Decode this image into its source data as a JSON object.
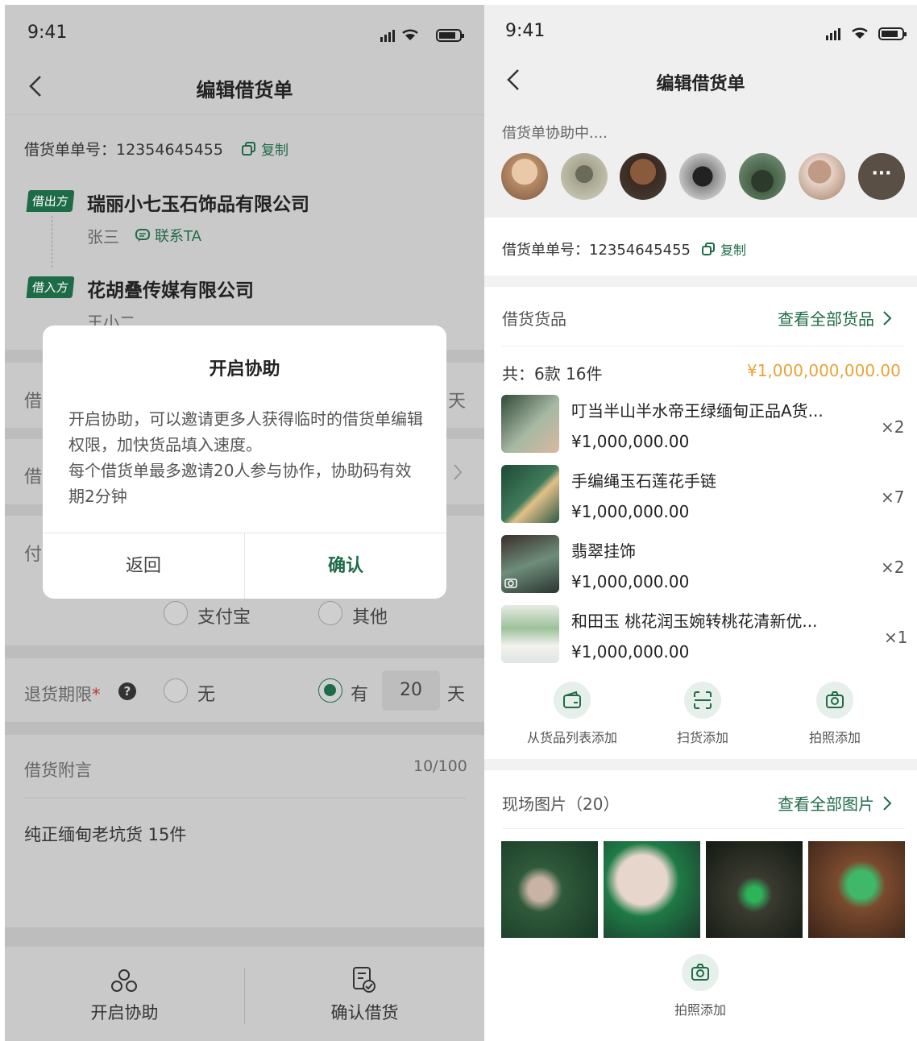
{
  "left": {
    "status_time": "9:41",
    "nav_title": "编辑借货单",
    "order_no_label": "借货单单号：12354645455",
    "copy_label": "复制",
    "lender_badge": "借出方",
    "lender_name": "瑞丽小七玉石饰品有限公司",
    "lender_contact": "张三",
    "contact_label": "联系TA",
    "borrower_badge": "借入方",
    "borrower_name": "花胡叠传媒有限公司",
    "borrower_contact": "王小二",
    "row1_label": "借",
    "row1_suffix": "天",
    "row2_label": "借",
    "row3_label": "付",
    "pay_alipay": "支付宝",
    "pay_other": "其他",
    "return_label": "退货期限",
    "required_mark": "*",
    "return_none": "无",
    "return_has": "有",
    "return_days": "20",
    "return_unit": "天",
    "note_label": "借货附言",
    "note_count": "10/100",
    "note_text": "纯正缅甸老坑货 15件",
    "btn_assist": "开启协助",
    "btn_confirm_borrow": "确认借货",
    "modal": {
      "title": "开启协助",
      "body1": "开启协助，可以邀请更多人获得临时的借货单编辑权限，加快货品填入速度。",
      "body2": "每个借货单最多邀请20人参与协作，协助码有效期2分钟",
      "cancel": "返回",
      "confirm": "确认"
    }
  },
  "right": {
    "status_time": "9:41",
    "nav_title": "编辑借货单",
    "assist_status": "借货单协助中....",
    "more_label": "···",
    "order_no_label": "借货单单号：12354645455",
    "copy_label": "复制",
    "goods_title": "借货货品",
    "goods_view_all": "查看全部货品",
    "total_label": "共：6款 16件",
    "total_price": "¥1,000,000,000.00",
    "items": [
      {
        "name": "叮当半山半水帝王绿缅甸正品A货...",
        "price": "¥1,000,000.00",
        "qty": "×2"
      },
      {
        "name": "手编绳玉石莲花手链",
        "price": "¥1,000,000.00",
        "qty": "×7"
      },
      {
        "name": "翡翠挂饰",
        "price": "¥1,000,000.00",
        "qty": "×2"
      },
      {
        "name": "和田玉 桃花润玉婉转桃花清新优...",
        "price": "¥1,000,000.00",
        "qty": "×1"
      }
    ],
    "add_from_list": "从货品列表添加",
    "add_scan": "扫货添加",
    "add_photo": "拍照添加",
    "scene_title": "现场图片（20）",
    "scene_view_all": "查看全部图片",
    "scene_add_photo": "拍照添加"
  },
  "colors": {
    "brand_green": "#1e6b47",
    "price_orange": "#e8a33a",
    "overlay_gray": "#c9c9c9"
  }
}
